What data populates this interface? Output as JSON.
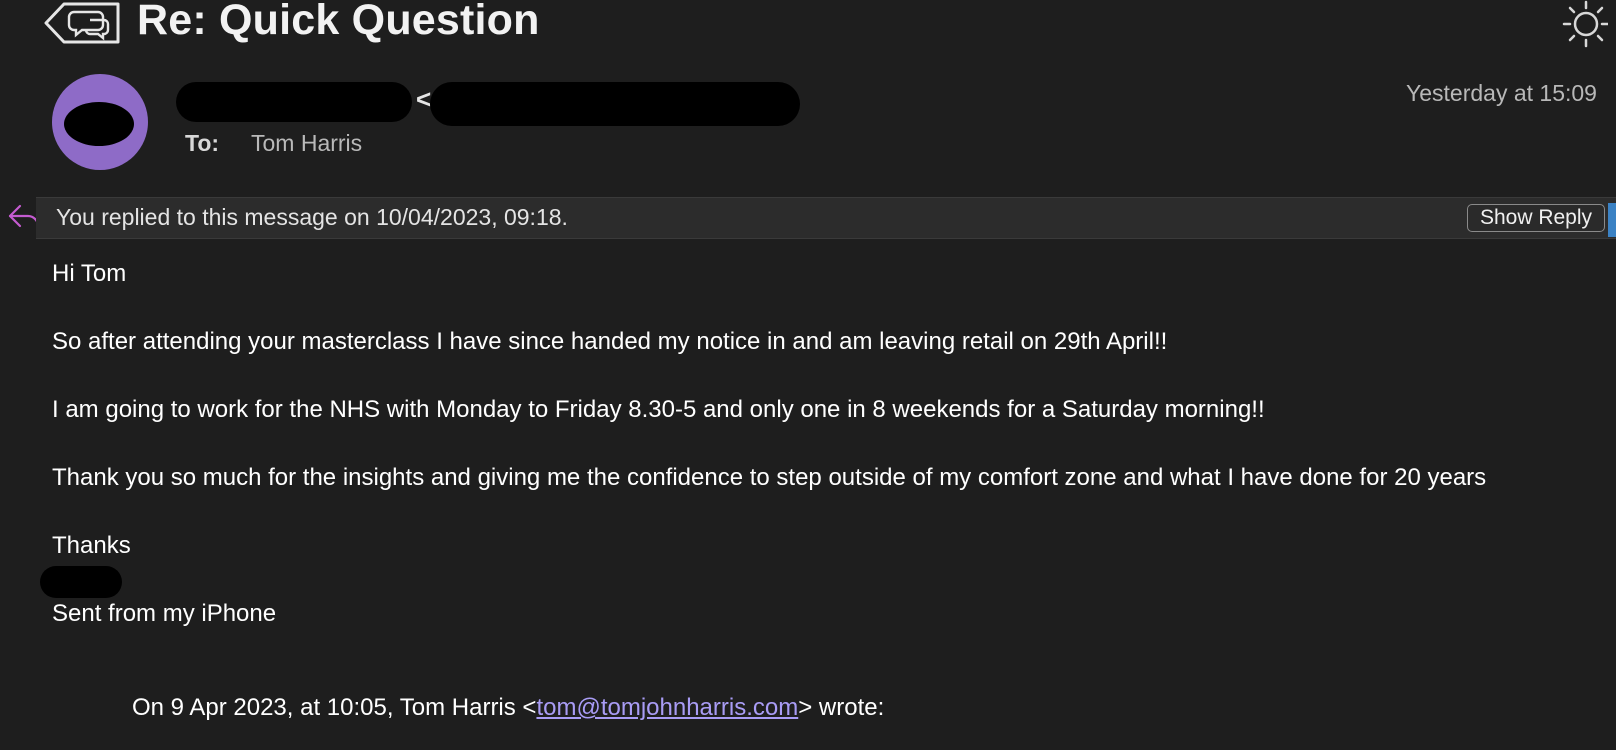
{
  "header": {
    "subject": "Re: Quick Question",
    "sender_separator": "<",
    "to_label": "To:",
    "to_value": "Tom Harris",
    "date": "Yesterday at 15:09"
  },
  "icons": {
    "back": "conversation-back-icon",
    "appearance": "sun-icon",
    "reply": "reply-arrow-icon"
  },
  "banner": {
    "text": "You replied to this message on 10/04/2023, 09:18.",
    "button_label": "Show Reply"
  },
  "body": {
    "greeting": "Hi Tom",
    "paragraph1": "So after attending your masterclass I have since handed my notice in and am leaving retail on 29th April!!",
    "paragraph2": "I am going to work for the NHS with Monday to Friday 8.30-5 and only one in 8 weekends for a Saturday morning!!",
    "paragraph3": "Thank you so much for the insights and giving me the confidence to step outside of my comfort zone and what I have done for 20 years",
    "signoff": "Thanks",
    "signature": "Sent from my iPhone"
  },
  "quote": {
    "prefix": "On 9 Apr 2023, at 10:05, Tom Harris <",
    "email": "tom@tomjohnharris.com",
    "suffix": "> wrote:"
  },
  "colors": {
    "background": "#1e1e1e",
    "avatar": "#8e6bc7",
    "banner": "#2c2c2c",
    "link": "#a99cf5",
    "reply_icon": "#c45bd0"
  }
}
